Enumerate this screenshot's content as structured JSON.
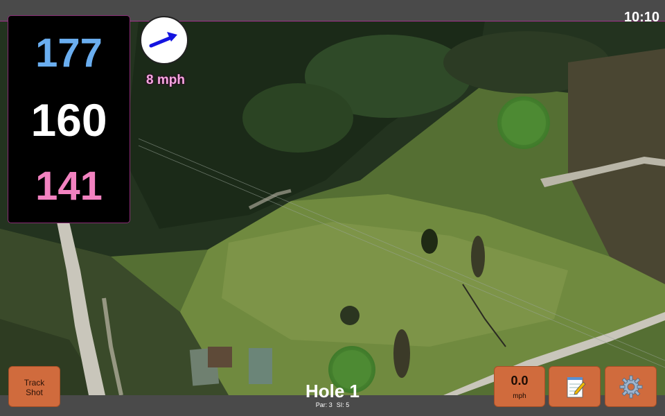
{
  "status": {
    "clock": "10:10"
  },
  "distances": {
    "back": "177",
    "middle": "160",
    "front": "141"
  },
  "wind": {
    "speed_label": "8 mph",
    "icon": "wind-arrow-icon"
  },
  "hole": {
    "title": "Hole 1",
    "par_label": "Par: 3",
    "si_label": "SI: 5"
  },
  "buttons": {
    "track_shot_line1": "Track",
    "track_shot_line2": "Shot",
    "speed_value": "0.0",
    "speed_unit": "mph",
    "notes_icon": "notepad-icon",
    "settings_icon": "gear-icon"
  },
  "colors": {
    "distance_back": "#6aaef0",
    "distance_middle": "#ffffff",
    "distance_front": "#f282c0",
    "wind_label": "#f6a7e0",
    "button": "#d06b3d",
    "bar": "#4a4a4a"
  }
}
